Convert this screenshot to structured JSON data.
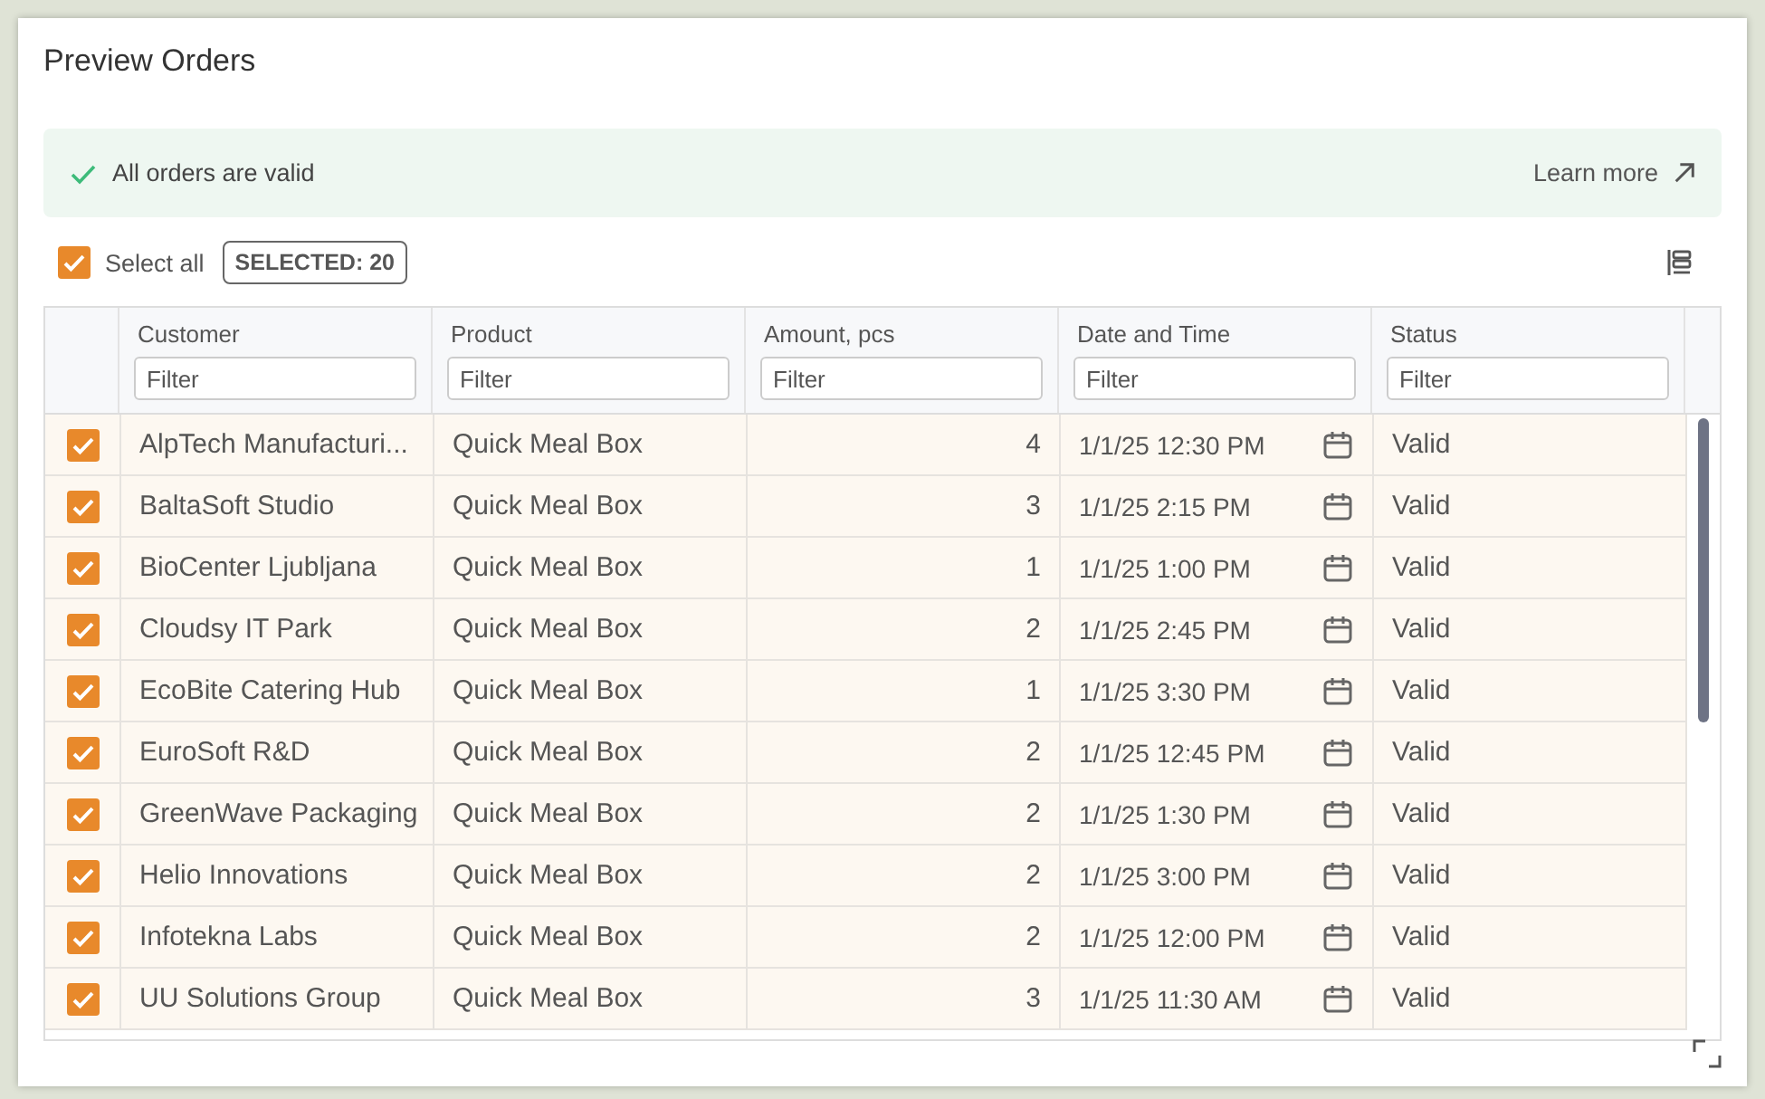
{
  "dialog": {
    "title": "Preview Orders"
  },
  "banner": {
    "message": "All orders are valid",
    "link": "Learn more"
  },
  "selection": {
    "select_all_label": "Select all",
    "select_all_checked": true,
    "selected_badge": "SELECTED: 20"
  },
  "table": {
    "columns": [
      {
        "label": "Customer",
        "placeholder": "Filter"
      },
      {
        "label": "Product",
        "placeholder": "Filter"
      },
      {
        "label": "Amount, pcs",
        "placeholder": "Filter"
      },
      {
        "label": "Date and Time",
        "placeholder": "Filter"
      },
      {
        "label": "Status",
        "placeholder": "Filter"
      }
    ],
    "rows": [
      {
        "checked": true,
        "customer": "AlpTech Manufacturi...",
        "product": "Quick Meal Box",
        "amount": "4",
        "datetime": "1/1/25 12:30 PM",
        "status": "Valid"
      },
      {
        "checked": true,
        "customer": "BaltaSoft Studio",
        "product": "Quick Meal Box",
        "amount": "3",
        "datetime": "1/1/25 2:15 PM",
        "status": "Valid"
      },
      {
        "checked": true,
        "customer": "BioCenter Ljubljana",
        "product": "Quick Meal Box",
        "amount": "1",
        "datetime": "1/1/25 1:00 PM",
        "status": "Valid"
      },
      {
        "checked": true,
        "customer": "Cloudsy IT Park",
        "product": "Quick Meal Box",
        "amount": "2",
        "datetime": "1/1/25 2:45 PM",
        "status": "Valid"
      },
      {
        "checked": true,
        "customer": "EcoBite Catering Hub",
        "product": "Quick Meal Box",
        "amount": "1",
        "datetime": "1/1/25 3:30 PM",
        "status": "Valid"
      },
      {
        "checked": true,
        "customer": "EuroSoft R&D",
        "product": "Quick Meal Box",
        "amount": "2",
        "datetime": "1/1/25 12:45 PM",
        "status": "Valid"
      },
      {
        "checked": true,
        "customer": "GreenWave Packaging",
        "product": "Quick Meal Box",
        "amount": "2",
        "datetime": "1/1/25 1:30 PM",
        "status": "Valid"
      },
      {
        "checked": true,
        "customer": "Helio Innovations",
        "product": "Quick Meal Box",
        "amount": "2",
        "datetime": "1/1/25 3:00 PM",
        "status": "Valid"
      },
      {
        "checked": true,
        "customer": "Infotekna Labs",
        "product": "Quick Meal Box",
        "amount": "2",
        "datetime": "1/1/25 12:00 PM",
        "status": "Valid"
      },
      {
        "checked": true,
        "customer": "UU Solutions Group",
        "product": "Quick Meal Box",
        "amount": "3",
        "datetime": "1/1/25 11:30 AM",
        "status": "Valid"
      }
    ]
  }
}
